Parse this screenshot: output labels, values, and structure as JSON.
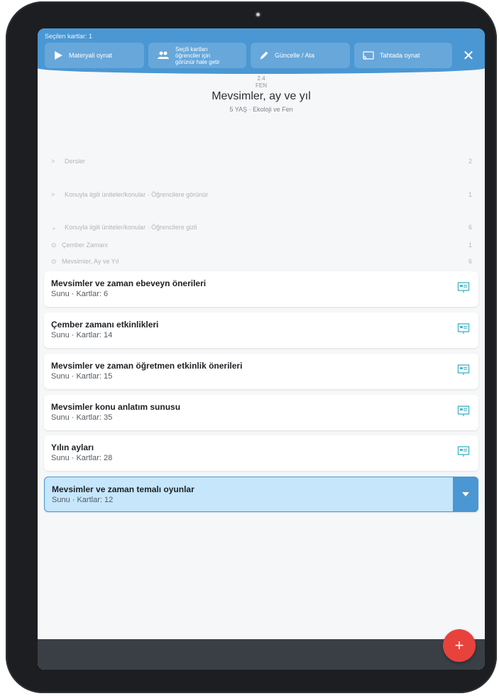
{
  "toolbar": {
    "selected_label": "Seçilen kartlar: 1",
    "buttons": [
      {
        "label": "Materyali oynat",
        "icon": "play-icon"
      },
      {
        "label_lines": [
          "Seçili kartları",
          "öğrenciler için",
          "görünür hale getir"
        ],
        "icon": "users-icon"
      },
      {
        "label": "Güncelle / Ata",
        "icon": "pencil-icon"
      },
      {
        "label": "Tahtada oynat",
        "icon": "cast-icon"
      }
    ],
    "close_icon": "close-icon"
  },
  "header": {
    "code": "2.4",
    "subject": "FEN",
    "title": "Mevsimler, ay ve yıl",
    "meta": "5 YAŞ · Ekoloji ve Fen"
  },
  "sections": [
    {
      "chevron": ">",
      "label": "Dersler",
      "count": "2"
    },
    {
      "chevron": ">",
      "label": "Konuyla ilgili üniteler/konular · Öğrencilere görünür",
      "count": "1"
    },
    {
      "chevron": "⌄",
      "label": "Konuyla ilgili üniteler/konular · Öğrencilere gizli",
      "count": "6"
    }
  ],
  "subitems": [
    {
      "bullet": "⊙",
      "label": "Çember Zamanı",
      "count": "1"
    },
    {
      "bullet": "⊙",
      "label": "Mevsimler, Ay ve Yıl",
      "count": "6"
    }
  ],
  "cards": [
    {
      "title": "Mevsimler ve zaman ebeveyn önerileri",
      "subtitle": "Sunu · Kartlar: 6"
    },
    {
      "title": "Çember zamanı etkinlikleri",
      "subtitle": "Sunu · Kartlar: 14"
    },
    {
      "title": "Mevsimler ve zaman öğretmen etkinlik önerileri",
      "subtitle": "Sunu · Kartlar: 15"
    },
    {
      "title": "Mevsimler konu anlatım sunusu",
      "subtitle": "Sunu · Kartlar: 35"
    },
    {
      "title": "Yılın ayları",
      "subtitle": "Sunu · Kartlar: 28"
    },
    {
      "title": "Mevsimler ve zaman temalı oyunlar",
      "subtitle": "Sunu · Kartlar: 12",
      "selected": true
    }
  ],
  "fab": {
    "label": "+"
  },
  "colors": {
    "accent": "#4a97d3",
    "selected_card": "#c5e6fb",
    "fab": "#e8423d",
    "bottom_bar": "#3a3f45"
  }
}
